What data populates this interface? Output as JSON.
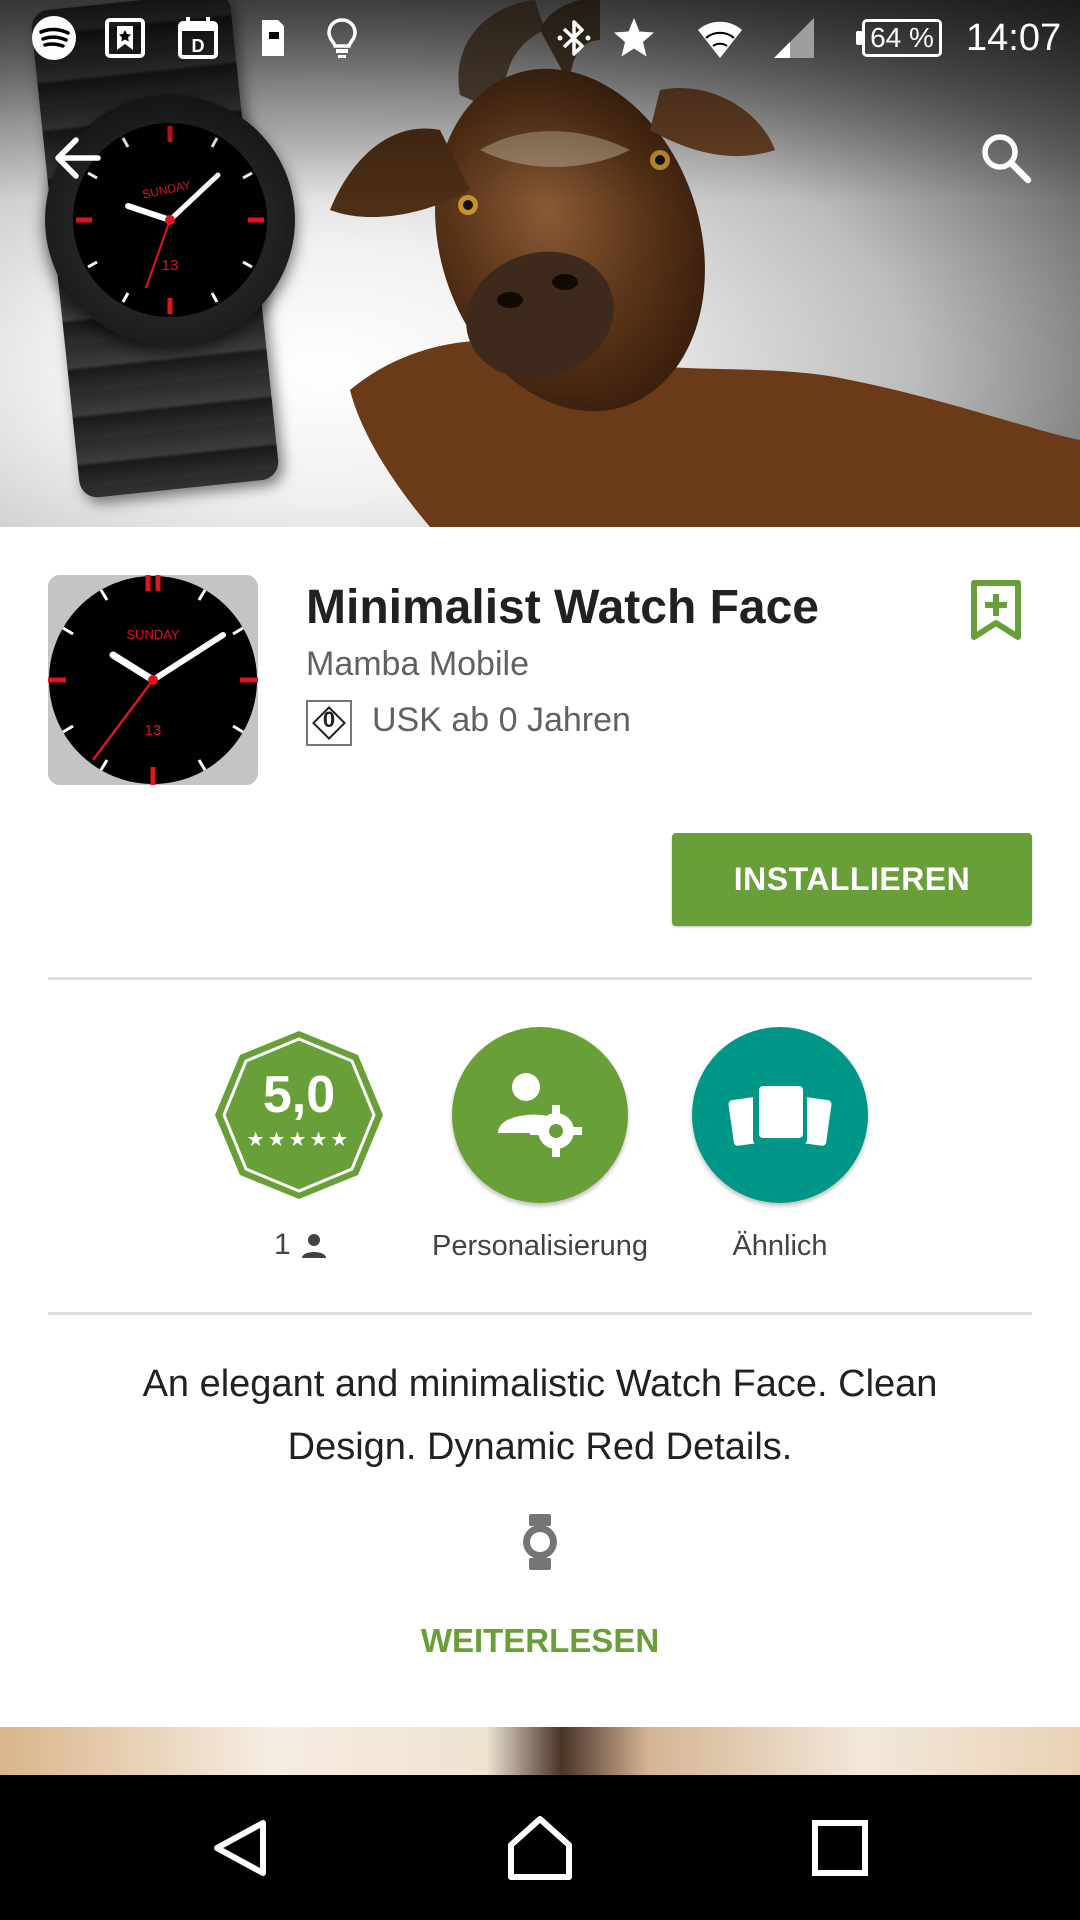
{
  "status_bar": {
    "notification_icons": [
      "spotify-icon",
      "bookmark-star-icon",
      "calendar-d-icon",
      "sd-card-icon",
      "lightbulb-icon"
    ],
    "system_icons": [
      "bluetooth-icon",
      "star-icon",
      "wifi-icon",
      "signal-icon"
    ],
    "battery": "64 %",
    "time": "14:07"
  },
  "app": {
    "title": "Minimalist Watch Face",
    "developer": "Mamba Mobile",
    "usk_number": "0",
    "usk_text": "USK ab 0 Jahren",
    "install_label": "INSTALLIEREN"
  },
  "icon_dial": {
    "day": "SUNDAY",
    "date": "13"
  },
  "badges": {
    "rating_value": "5,0",
    "rating_stars": "★★★★★",
    "rating_count": "1",
    "category_label": "Personalisierung",
    "similar_label": "Ähnlich"
  },
  "description": {
    "text": "An elegant and minimalistic Watch Face. Clean Design. Dynamic Red Details.",
    "read_more": "WEITERLESEN"
  },
  "colors": {
    "accent_green": "#689f38",
    "teal": "#009688",
    "watch_red": "#e0141e"
  }
}
